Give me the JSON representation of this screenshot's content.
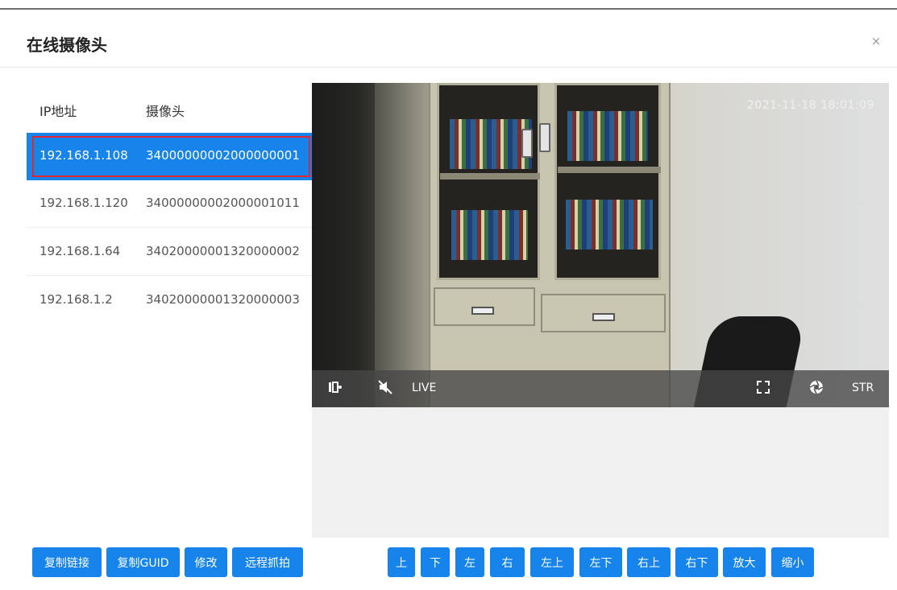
{
  "dialog": {
    "title": "在线摄像头",
    "close_glyph": "×"
  },
  "table": {
    "headers": {
      "ip": "IP地址",
      "camera": "摄像头"
    },
    "rows": [
      {
        "ip": "192.168.1.108",
        "camera": "34000000002000000001",
        "selected": true
      },
      {
        "ip": "192.168.1.120",
        "camera": "34000000002000001011",
        "selected": false
      },
      {
        "ip": "192.168.1.64",
        "camera": "34020000001320000002",
        "selected": false
      },
      {
        "ip": "192.168.1.2",
        "camera": "34020000001320000003",
        "selected": false
      }
    ]
  },
  "video": {
    "timestamp": "2021-11-18 18:01:09",
    "bar": {
      "live_label": "LIVE",
      "str_label": "STR"
    }
  },
  "left_buttons": {
    "copy_link": "复制链接",
    "copy_guid": "复制GUID",
    "edit": "修改",
    "remote_snapshot": "远程抓拍"
  },
  "ptz_buttons": {
    "up": "上",
    "down": "下",
    "left": "左",
    "right": "右",
    "up_left": "左上",
    "down_left": "左下",
    "up_right": "右上",
    "down_right": "右下",
    "zoom_in": "放大",
    "zoom_out": "缩小"
  },
  "colors": {
    "accent": "#1684ea",
    "selection_outline": "#e02630"
  }
}
